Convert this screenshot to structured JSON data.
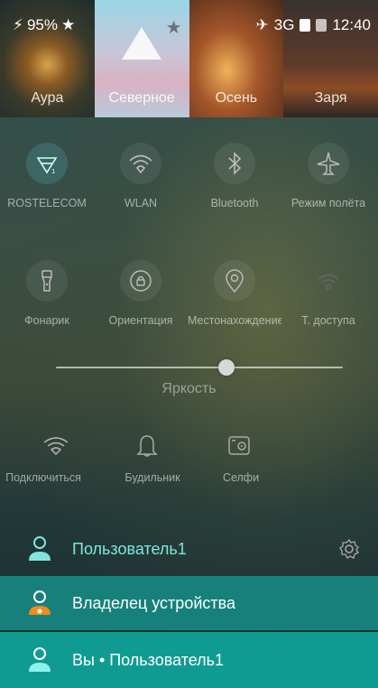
{
  "status_bar": {
    "battery": "95%",
    "network": "3G",
    "time": "12:40"
  },
  "themes": [
    {
      "label": "Аура"
    },
    {
      "label": "Северное"
    },
    {
      "label": "Осень"
    },
    {
      "label": "Заря"
    }
  ],
  "toggles_row1": [
    {
      "label": "ROSTELECOM",
      "icon": "wifi-signal-icon"
    },
    {
      "label": "WLAN",
      "icon": "wifi-icon"
    },
    {
      "label": "Bluetooth",
      "icon": "bluetooth-icon"
    },
    {
      "label": "Режим полёта",
      "icon": "airplane-icon"
    }
  ],
  "toggles_row2": [
    {
      "label": "Фонарик",
      "icon": "flashlight-icon"
    },
    {
      "label": "Ориентация",
      "icon": "rotation-lock-icon"
    },
    {
      "label": "Местонахождение",
      "icon": "location-icon"
    },
    {
      "label": "Т. доступа",
      "icon": "hotspot-icon"
    }
  ],
  "brightness": {
    "label": "Яркость",
    "level": 0.6
  },
  "toggles_row3": [
    {
      "label": "Подключиться",
      "icon": "connect-icon"
    },
    {
      "label": "Будильник",
      "icon": "alarm-bell-icon"
    },
    {
      "label": "Селфи",
      "icon": "camera-icon"
    }
  ],
  "users": {
    "current": "Пользователь1",
    "owner": "Владелец устройства",
    "you": "Вы • Пользователь1"
  },
  "colors": {
    "accent": "#109b92",
    "owner_row": "#16817a",
    "current_user_text": "#7fe6df"
  }
}
